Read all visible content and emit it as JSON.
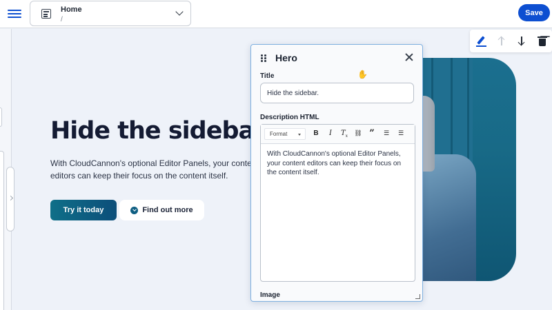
{
  "topbar": {
    "page_name": "Home",
    "page_path": "/",
    "save_label": "Save"
  },
  "hero": {
    "title": "Hide the sidebar.",
    "description_lines": [
      "With CloudCannon's optional Editor Panels, your content",
      "editors can keep their focus on the content itself."
    ],
    "primary_button": "Try it today",
    "secondary_button": "Find out more"
  },
  "block_toolbar": {
    "icons": [
      "pencil-icon",
      "arrow-up-icon",
      "arrow-down-icon",
      "trash-icon"
    ]
  },
  "panel": {
    "title": "Hero",
    "title_label": "Title",
    "title_value": "Hide the sidebar.",
    "description_label": "Description HTML",
    "format_label": "Format",
    "description_lines": [
      "With CloudCannon's optional Editor Panels,",
      "your content editors can keep their focus on",
      "the content itself."
    ],
    "image_label": "Image"
  },
  "colors": {
    "accent": "#0d4fd1",
    "primary_button": "#0f6f88",
    "panel_border": "#7fb0e0"
  }
}
